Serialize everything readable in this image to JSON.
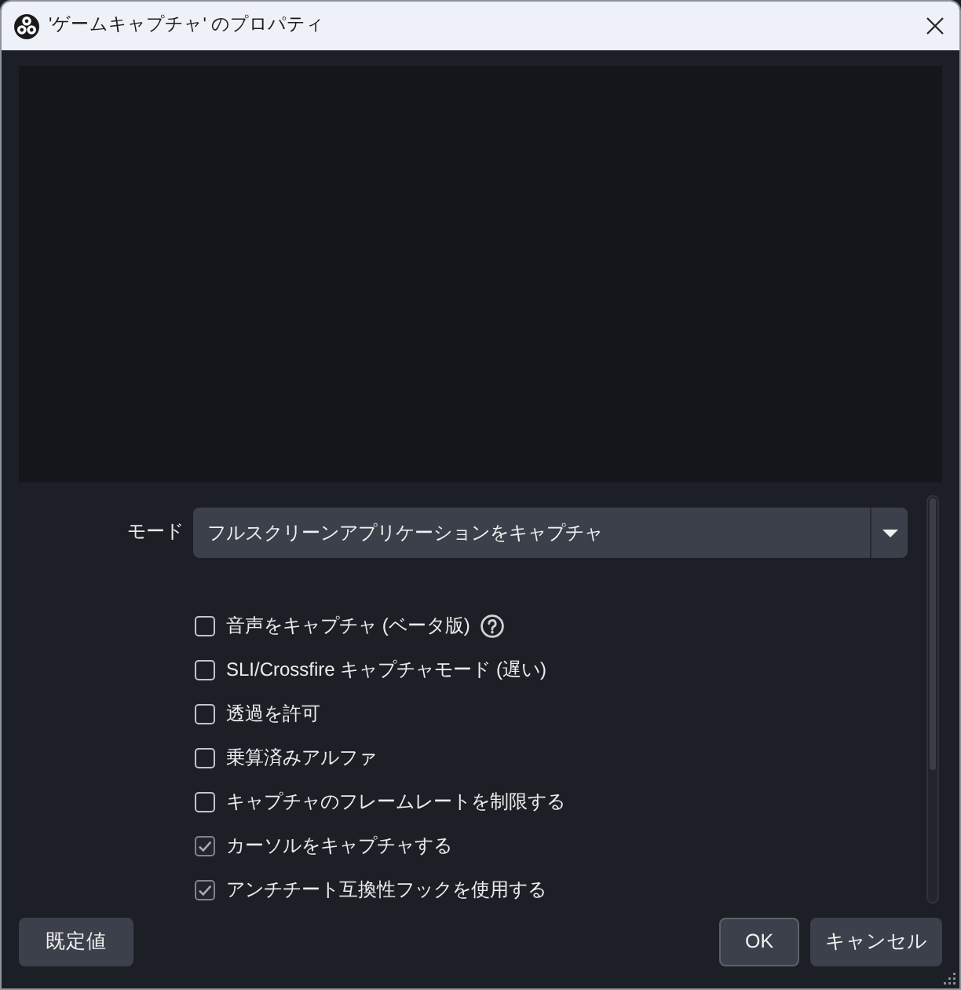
{
  "window": {
    "title": "'ゲームキャプチャ' のプロパティ"
  },
  "properties": {
    "mode": {
      "label": "モード",
      "value": "フルスクリーンアプリケーションをキャプチャ"
    },
    "options": [
      {
        "label": "音声をキャプチャ (ベータ版)",
        "checked": false,
        "help": true
      },
      {
        "label": "SLI/Crossfire キャプチャモード (遅い)",
        "checked": false,
        "help": false
      },
      {
        "label": "透過を許可",
        "checked": false,
        "help": false
      },
      {
        "label": "乗算済みアルファ",
        "checked": false,
        "help": false
      },
      {
        "label": "キャプチャのフレームレートを制限する",
        "checked": false,
        "help": false
      },
      {
        "label": "カーソルをキャプチャする",
        "checked": true,
        "help": false
      },
      {
        "label": "アンチチート互換性フックを使用する",
        "checked": true,
        "help": false
      }
    ]
  },
  "buttons": {
    "defaults": "既定値",
    "ok": "OK",
    "cancel": "キャンセル"
  }
}
